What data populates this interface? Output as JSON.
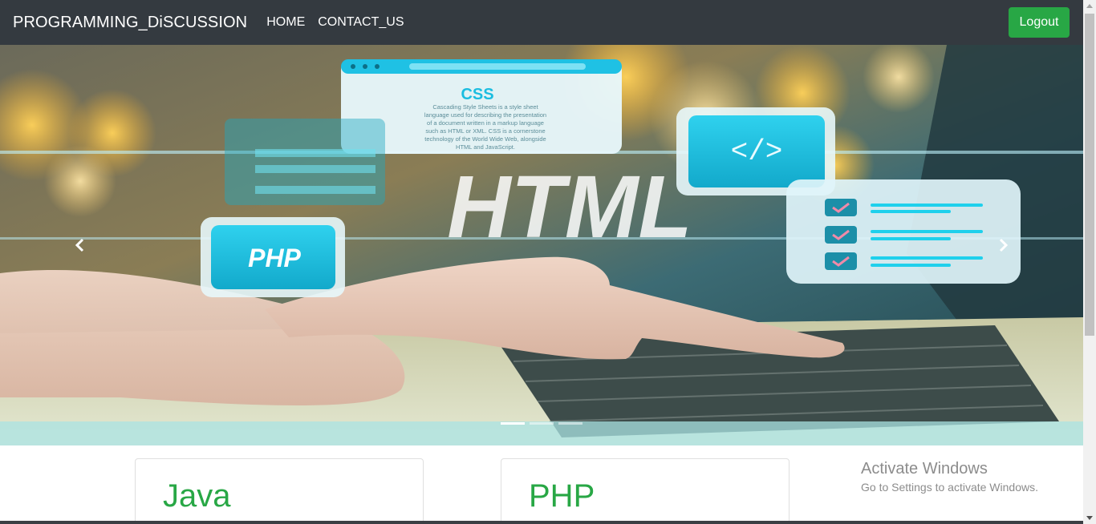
{
  "navbar": {
    "brand": "PROGRAMMING_DiSCUSSION",
    "links": [
      "HOME",
      "CONTACT_US"
    ],
    "logout_label": "Logout"
  },
  "carousel": {
    "slide": {
      "css_card_title": "CSS",
      "css_card_text": [
        "Cascading Style Sheets is a style sheet",
        "language used for describing the presentation",
        "of a document written in a markup language",
        "such as HTML or XML. CSS is a cornerstone",
        "technology of the World Wide Web, alongside",
        "HTML and JavaScript."
      ],
      "code_icon_text": "</>",
      "big_text": "HTML",
      "php_icon_text": "PHP"
    },
    "indicator_count": 3,
    "active_index": 0
  },
  "cards": [
    {
      "title": "Java"
    },
    {
      "title": "PHP"
    }
  ],
  "watermark": {
    "title": "Activate Windows",
    "subtitle": "Go to Settings to activate Windows."
  },
  "colors": {
    "navbar_bg": "#343a40",
    "accent_green": "#28a745"
  }
}
